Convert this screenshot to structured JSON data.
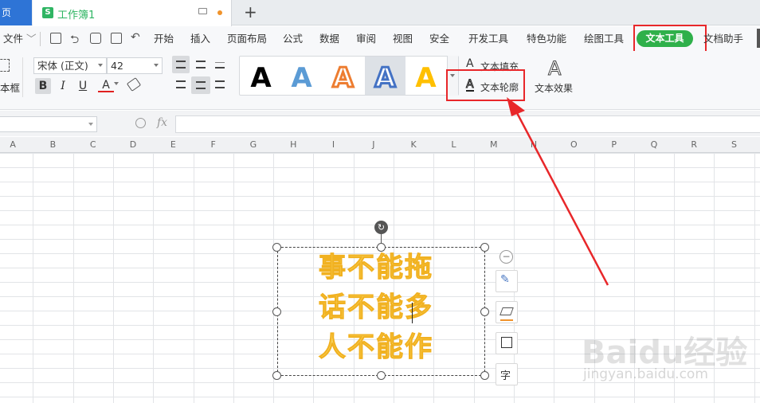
{
  "titlebar": {
    "home_tab": "页",
    "doc_tab": "工作簿1",
    "doc_icon_letter": "S",
    "new_tab": "+"
  },
  "menubar": {
    "file": "文件",
    "items": [
      "开始",
      "插入",
      "页面布局",
      "公式",
      "数据",
      "审阅",
      "视图",
      "安全",
      "开发工具",
      "特色功能",
      "绘图工具"
    ],
    "active": "文本工具",
    "after_active": "文档助手"
  },
  "ribbon": {
    "textbox_label": "本框",
    "font_name": "宋体 (正文)",
    "font_size": "42",
    "bold": "B",
    "italic": "I",
    "underline": "U",
    "font_color": "A",
    "style_letter": "A",
    "text_fill": "文本填充",
    "text_outline": "文本轮廓",
    "text_effect": "文本效果",
    "effect_letter": "A"
  },
  "formula_bar": {
    "fx": "fx",
    "value": ""
  },
  "columns": [
    "A",
    "B",
    "C",
    "D",
    "E",
    "F",
    "G",
    "H",
    "I",
    "J",
    "K",
    "L",
    "M",
    "N",
    "O",
    "P",
    "Q",
    "R",
    "S"
  ],
  "textbox": {
    "lines": [
      "事不能拖",
      "话不能多",
      "人不能作"
    ]
  },
  "side_tools": {
    "char_label": "字"
  },
  "watermark": {
    "brand": "Baidu经验",
    "url": "jingyan.baidu.com"
  },
  "colors": {
    "accent_blue": "#2e74d6",
    "active_tab_green": "#2fb04a",
    "highlight_red": "#e8272a",
    "text_fill_yellow": "#f8d259"
  }
}
